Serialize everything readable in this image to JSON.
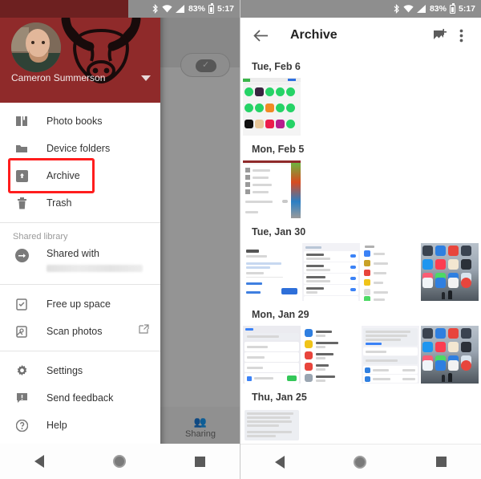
{
  "status_bar": {
    "bluetooth_icon": "bluetooth-icon",
    "wifi_icon": "wifi-icon",
    "signal_icon": "signal-icon",
    "battery_text": "83%",
    "battery_icon": "battery-icon",
    "time": "5:17"
  },
  "left_screen": {
    "drawer": {
      "account": {
        "name": "Cameron Summerson",
        "avatar_icon": "avatar",
        "logo_icon": "bulls-logo",
        "expand_icon": "chevron-down-icon"
      },
      "items": [
        {
          "label": "Photo books",
          "icon": "photo-book-icon",
          "name": "photo-books"
        },
        {
          "label": "Device folders",
          "icon": "folder-icon",
          "name": "device-folders"
        },
        {
          "label": "Archive",
          "icon": "archive-icon",
          "name": "archive",
          "highlighted": true
        },
        {
          "label": "Trash",
          "icon": "trash-icon",
          "name": "trash"
        }
      ],
      "shared_section_label": "Shared library",
      "shared_with": {
        "label": "Shared with",
        "icon": "shared-icon",
        "subtitle_blurred": true
      },
      "items2": [
        {
          "label": "Free up space",
          "icon": "free-up-space-icon",
          "name": "free-up-space"
        },
        {
          "label": "Scan photos",
          "icon": "scan-photos-icon",
          "name": "scan-photos",
          "external": true,
          "external_icon": "external-link-icon"
        }
      ],
      "items3": [
        {
          "label": "Settings",
          "icon": "gear-icon",
          "name": "settings"
        },
        {
          "label": "Send feedback",
          "icon": "feedback-icon",
          "name": "send-feedback"
        },
        {
          "label": "Help",
          "icon": "help-icon",
          "name": "help"
        }
      ]
    },
    "background": {
      "sharing_tab_label": "Sharing",
      "sharing_tab_icon": "sharing-icon",
      "cloud_badge_icon": "cloud-done-icon"
    },
    "nav_bar": {
      "back_icon": "back-triangle-icon",
      "home_icon": "home-circle-icon",
      "recents_icon": "recents-square-icon"
    }
  },
  "right_screen": {
    "appbar": {
      "back_icon": "arrow-back-icon",
      "title": "Archive",
      "unarchive_icon": "unarchive-photo-icon",
      "overflow_icon": "more-vert-icon"
    },
    "groups": [
      {
        "date": "Tue, Feb 6",
        "thumbs": [
          "whatsapp-icons-screenshot"
        ]
      },
      {
        "date": "Mon, Feb 5",
        "thumbs": [
          "settings-menu-screenshot"
        ]
      },
      {
        "date": "Tue, Jan 30",
        "thumbs": [
          "google-signin-screenshot",
          "sync-settings-screenshot",
          "ios-apps-list-screenshot",
          "ios-homescreen-screenshot"
        ]
      },
      {
        "date": "Mon, Jan 29",
        "thumbs": [
          "location-settings-screenshot",
          "ios-app-list-screenshot",
          "share-location-screenshot",
          "ios-homescreen-screenshot-2"
        ]
      },
      {
        "date": "Thu, Jan 25",
        "thumbs": [
          "battery-percentage-screenshot"
        ]
      }
    ],
    "nav_bar": {
      "back_icon": "back-triangle-icon",
      "home_icon": "home-circle-icon",
      "recents_icon": "recents-square-icon"
    }
  },
  "colors": {
    "drawer_header": "#8f2a2a",
    "highlight": "#ff1d1d",
    "status_bar_gray": "#8e8e8e",
    "accent_green": "#34c759"
  }
}
